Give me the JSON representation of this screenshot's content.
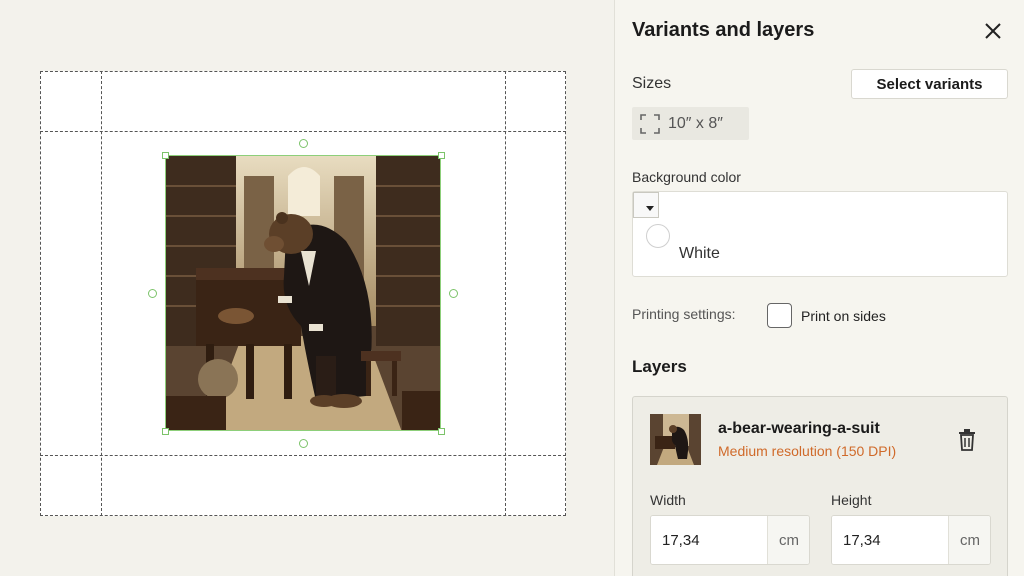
{
  "panel": {
    "title": "Variants and layers",
    "sizes": {
      "label": "Sizes",
      "select_button": "Select variants",
      "selected_size": "10″ x 8″"
    },
    "background_color": {
      "label": "Background color",
      "selected_color_name": "White",
      "selected_color_hex": "#ffffff"
    },
    "printing": {
      "label": "Printing settings:",
      "print_on_sides_label": "Print on sides",
      "print_on_sides_checked": false
    },
    "layers": {
      "label": "Layers",
      "items": [
        {
          "name": "a-bear-wearing-a-suit",
          "resolution": "Medium resolution (150 DPI)",
          "width_label": "Width",
          "width_value": "17,34",
          "width_unit": "cm",
          "height_label": "Height",
          "height_value": "17,34",
          "height_unit": "cm"
        }
      ]
    }
  },
  "icons": {
    "close": "close-icon",
    "frame": "frame-corners-icon",
    "trash": "trash-icon",
    "caret": "caret-down-icon"
  },
  "colors": {
    "selection_handle": "#7cc36a",
    "resolution_warning": "#d06a2a",
    "panel_bg": "#f6f5ef"
  }
}
